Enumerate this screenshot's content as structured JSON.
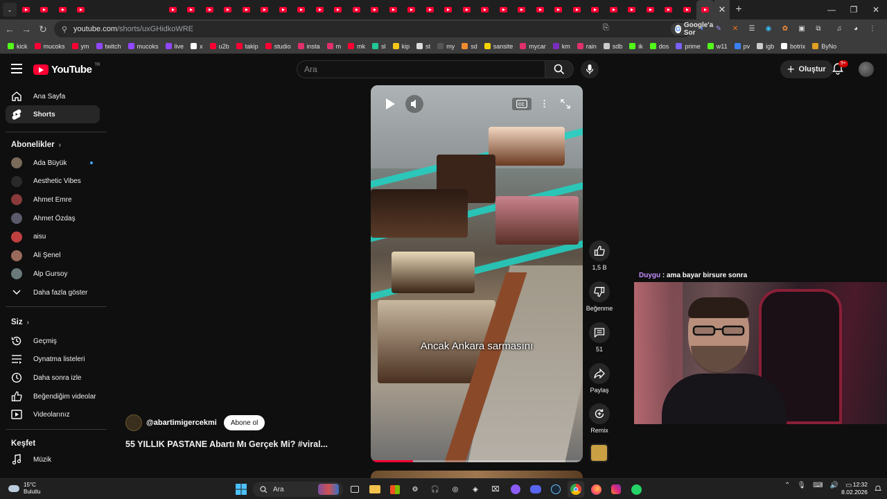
{
  "browser": {
    "tab_count_left": 4,
    "tab_count_right": 29,
    "url_domain": "youtube.com",
    "url_path": "/shorts/uxGHidkoWRE",
    "google_lens_label": "Google'a Sor"
  },
  "bookmarks": [
    {
      "label": "kick",
      "color": "#53fc18"
    },
    {
      "label": "mucoks",
      "color": "#ff0033"
    },
    {
      "label": "ym",
      "color": "#ff0033"
    },
    {
      "label": "twitch",
      "color": "#9146ff"
    },
    {
      "label": "mucoks",
      "color": "#9146ff"
    },
    {
      "label": "live",
      "color": "#9146ff"
    },
    {
      "label": "x",
      "color": "#ffffff"
    },
    {
      "label": "u2b",
      "color": "#ff0033"
    },
    {
      "label": "takip",
      "color": "#ff0033"
    },
    {
      "label": "studio",
      "color": "#ff0033"
    },
    {
      "label": "insta",
      "color": "#e1306c"
    },
    {
      "label": "m",
      "color": "#e1306c"
    },
    {
      "label": "mk",
      "color": "#ff0033"
    },
    {
      "label": "sl",
      "color": "#20c997"
    },
    {
      "label": "kip",
      "color": "#f5c518"
    },
    {
      "label": "st",
      "color": "#dddddd"
    },
    {
      "label": "my",
      "color": "#555555"
    },
    {
      "label": "sd",
      "color": "#f08c2e"
    },
    {
      "label": "sansite",
      "color": "#f5d400"
    },
    {
      "label": "mycar",
      "color": "#e1306c"
    },
    {
      "label": "km",
      "color": "#7b2cbf"
    },
    {
      "label": "rain",
      "color": "#e1306c"
    },
    {
      "label": "sdb",
      "color": "#cccccc"
    },
    {
      "label": "ik",
      "color": "#53fc18"
    },
    {
      "label": "dos",
      "color": "#53fc18"
    },
    {
      "label": "prime",
      "color": "#7b61ff"
    },
    {
      "label": "w11",
      "color": "#53fc18"
    },
    {
      "label": "pv",
      "color": "#3b82f6"
    },
    {
      "label": "igb",
      "color": "#cccccc"
    },
    {
      "label": "botrix",
      "color": "#ffffff"
    },
    {
      "label": "ByNo",
      "color": "#e0a020"
    }
  ],
  "header": {
    "logo_text": "YouTube",
    "country_code": "TR",
    "search_placeholder": "Ara",
    "create_label": "Oluştur",
    "notification_badge": "9+"
  },
  "sidebar": {
    "main": [
      {
        "label": "Ana Sayfa",
        "icon": "home-icon",
        "active": false
      },
      {
        "label": "Shorts",
        "icon": "shorts-icon",
        "active": true
      }
    ],
    "subscriptions_heading": "Abonelikler",
    "subscriptions": [
      {
        "label": "Ada Büyük",
        "new": true,
        "color": "#7a6a5a"
      },
      {
        "label": "Aesthetic Vibes",
        "new": false,
        "color": "#2a2a2a"
      },
      {
        "label": "Ahmet Emre",
        "new": false,
        "color": "#8a3a3a"
      },
      {
        "label": "Ahmet Özdaş",
        "new": false,
        "color": "#5a5a6a"
      },
      {
        "label": "aisu",
        "new": false,
        "color": "#c04040"
      },
      {
        "label": "Ali Şenel",
        "new": false,
        "color": "#9a6a5a"
      },
      {
        "label": "Alp Gursoy",
        "new": false,
        "color": "#6a7a7a"
      }
    ],
    "show_more_label": "Daha fazla göster",
    "you_heading": "Siz",
    "you_items": [
      {
        "label": "Geçmiş",
        "icon": "history-icon"
      },
      {
        "label": "Oynatma listeleri",
        "icon": "playlists-icon"
      },
      {
        "label": "Daha sonra izle",
        "icon": "watch-later-icon"
      },
      {
        "label": "Beğendiğim videolar",
        "icon": "liked-videos-icon"
      },
      {
        "label": "Videolarınız",
        "icon": "your-videos-icon"
      }
    ],
    "explore_heading": "Keşfet",
    "explore_items": [
      {
        "label": "Müzik",
        "icon": "music-icon"
      }
    ]
  },
  "short": {
    "caption": "Ancak Ankara sarmasını",
    "progress_fraction": 0.2,
    "channel_handle": "@abartimigercekmi",
    "subscribe_label": "Abone ol",
    "title": "55 YILLIK PASTANE Abartı Mı Gerçek Mi? #viral..."
  },
  "actions": {
    "like_count": "1,5 B",
    "dislike_label": "Beğenme",
    "comment_count": "51",
    "share_label": "Paylaş",
    "remix_label": "Remix"
  },
  "overlay": {
    "chat_user": "Duygu",
    "chat_message": " : ama bayar birsure sonra"
  },
  "taskbar": {
    "weather_temp": "15°C",
    "weather_desc": "Bulutlu",
    "search_label": "Ara",
    "time": "12:32",
    "date": "8.02.2026"
  }
}
